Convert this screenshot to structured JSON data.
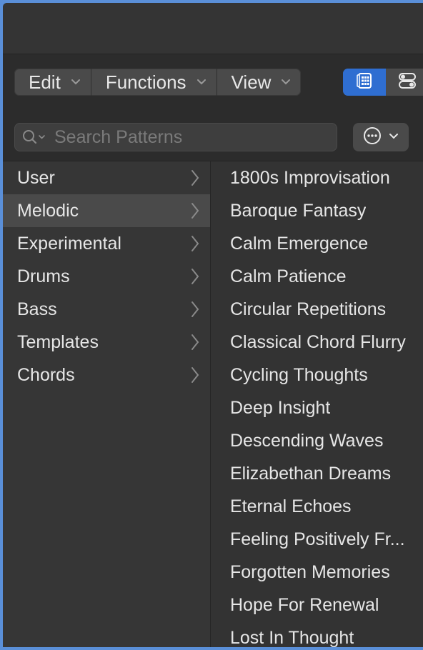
{
  "toolbar": {
    "menus": [
      {
        "label": "Edit",
        "icon": "chevron-down-icon"
      },
      {
        "label": "Functions",
        "icon": "chevron-down-icon"
      },
      {
        "label": "View",
        "icon": "chevron-down-icon"
      }
    ],
    "modes": [
      {
        "icon": "grid-icon",
        "active": true
      },
      {
        "icon": "toggles-icon",
        "active": false
      }
    ]
  },
  "search": {
    "placeholder": "Search Patterns",
    "value": ""
  },
  "colors": {
    "accent": "#2f6ed1",
    "background": "#333333",
    "text": "#e6e6e6"
  },
  "categories": [
    {
      "label": "User",
      "selected": false
    },
    {
      "label": "Melodic",
      "selected": true
    },
    {
      "label": "Experimental",
      "selected": false
    },
    {
      "label": "Drums",
      "selected": false
    },
    {
      "label": "Bass",
      "selected": false
    },
    {
      "label": "Templates",
      "selected": false
    },
    {
      "label": "Chords",
      "selected": false
    }
  ],
  "patterns": [
    "1800s Improvisation",
    "Baroque Fantasy",
    "Calm Emergence",
    "Calm Patience",
    "Circular Repetitions",
    "Classical Chord Flurry",
    "Cycling Thoughts",
    "Deep Insight",
    "Descending Waves",
    "Elizabethan Dreams",
    "Eternal Echoes",
    "Feeling Positively Fr...",
    "Forgotten Memories",
    "Hope For Renewal",
    "Lost In Thought"
  ]
}
